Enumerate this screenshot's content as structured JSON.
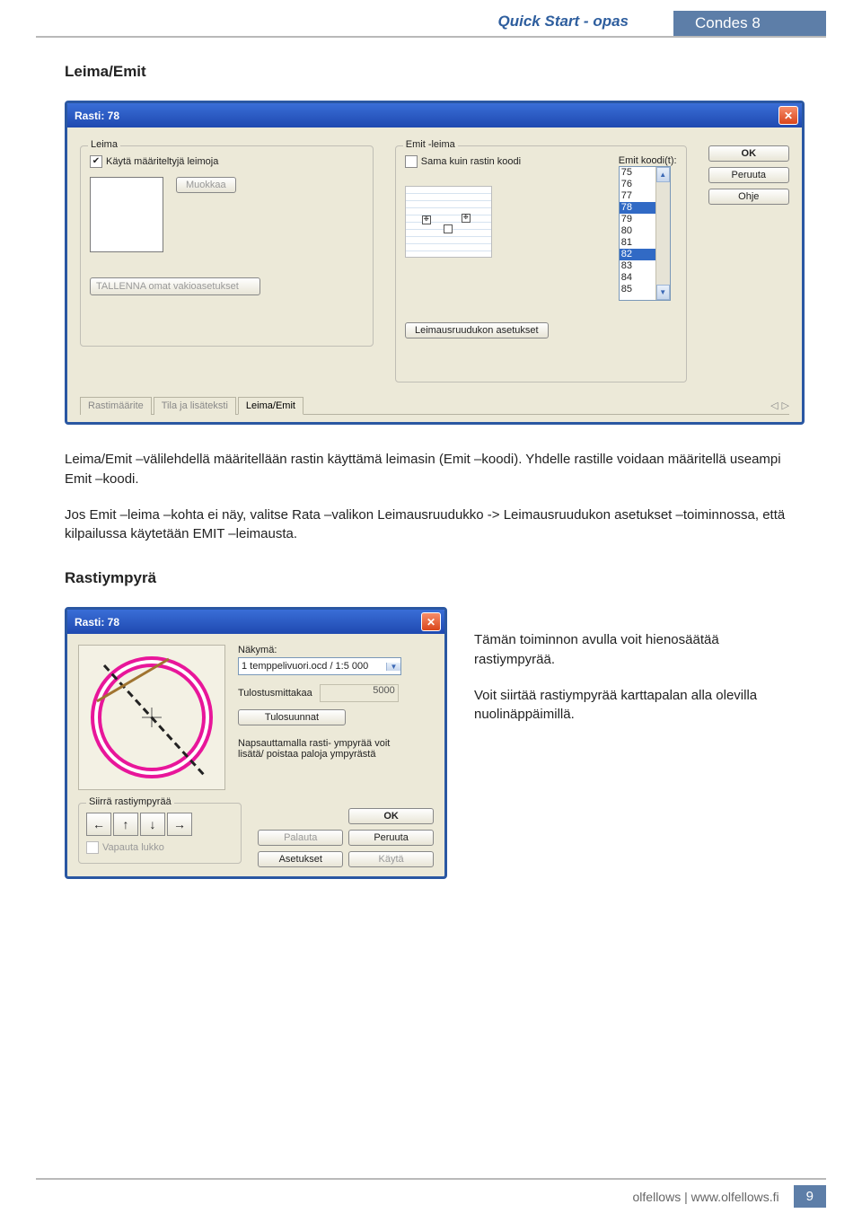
{
  "header": {
    "title": "Quick Start - opas",
    "badge": "Condes 8"
  },
  "section1": {
    "heading": "Leima/Emit",
    "dialog": {
      "title": "Rasti: 78",
      "leima": {
        "legend": "Leima",
        "use_defined": "Käytä määriteltyjä leimoja",
        "edit": "Muokkaa",
        "save_defaults": "TALLENNA omat vakioasetukset"
      },
      "emit": {
        "legend": "Emit -leima",
        "same_as": "Sama kuin rastin koodi",
        "codes_label": "Emit koodi(t):",
        "codes": [
          "75",
          "76",
          "77",
          "78",
          "79",
          "80",
          "81",
          "82",
          "83",
          "84",
          "85"
        ],
        "grid_settings": "Leimausruudukon asetukset"
      },
      "buttons": {
        "ok": "OK",
        "cancel": "Peruuta",
        "help": "Ohje"
      },
      "tabs": [
        "Rastimäärite",
        "Tila ja lisäteksti",
        "Leima/Emit"
      ]
    },
    "para1": "Leima/Emit –välilehdellä määritellään rastin käyttämä leimasin (Emit –koodi). Yhdelle rastille voidaan määritellä useampi Emit –koodi.",
    "para2": "Jos Emit –leima –kohta ei näy, valitse Rata –valikon Leimausruudukko -> Leimausruudukon asetukset –toiminnossa, että kilpailussa käytetään EMIT –leimausta."
  },
  "section2": {
    "heading": "Rastiympyrä",
    "dialog": {
      "title": "Rasti: 78",
      "view_label": "Näkymä:",
      "view_value": "1 temppelivuori.ocd  / 1:5 000",
      "scale_label": "Tulostusmittakaa",
      "scale_value": "5000",
      "directions": "Tulosuunnat",
      "hint": "Napsauttamalla rasti- ympyrää voit lisätä/ poistaa paloja ympyrästä",
      "move_legend": "Siirrä rastiympyrää",
      "release_lock": "Vapauta lukko",
      "buttons": {
        "ok": "OK",
        "restore": "Palauta",
        "settings": "Asetukset",
        "cancel": "Peruuta",
        "apply": "Käytä"
      }
    },
    "para1": "Tämän toiminnon avulla voit hienosäätää rastiympyrää.",
    "para2": "Voit siirtää rastiympyrää karttapalan alla olevilla nuolinäppäimillä."
  },
  "footer": {
    "text": "olfellows | www.olfellows.fi",
    "page": "9"
  }
}
